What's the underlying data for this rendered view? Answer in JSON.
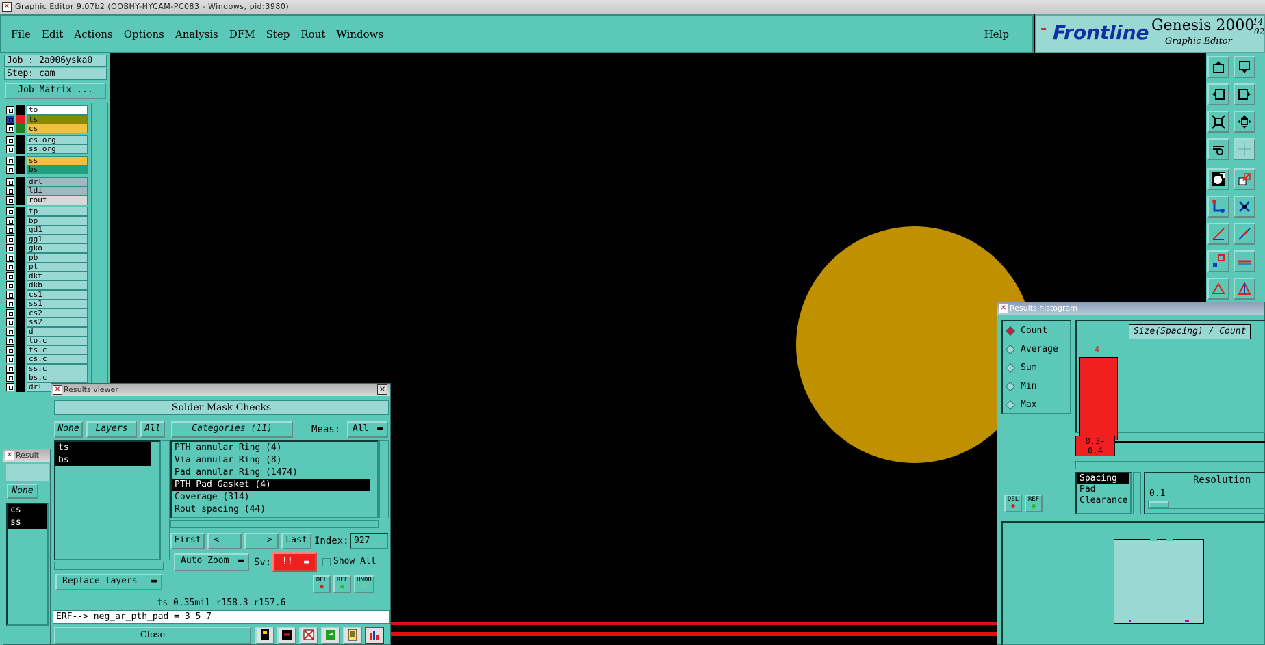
{
  "window": {
    "title": "Graphic Editor 9.07b2 (OOBHY-HYCAM-PC083 - Windows, pid:3980)"
  },
  "menu": {
    "items": [
      "File",
      "Edit",
      "Actions",
      "Options",
      "Analysis",
      "DFM",
      "Step",
      "Rout",
      "Windows"
    ],
    "help": "Help"
  },
  "logo": {
    "brand": "Frontline",
    "product": "Genesis 2000",
    "subtitle": "Graphic Editor",
    "version_top": "14",
    "version_bottom": "02"
  },
  "job": {
    "job_label": "Job : 2a006yska0",
    "step_label": "Step: cam",
    "matrix_button": "Job Matrix ..."
  },
  "layers": [
    {
      "name": "to",
      "color": "#ffffff"
    },
    {
      "name": "ts",
      "color": "#8a8a00",
      "swatch": "#e02020",
      "active": true
    },
    {
      "name": "cs",
      "color": "#f0c040",
      "swatch": "#208020"
    },
    {
      "name": "cs.org",
      "color": "#9ad8d4"
    },
    {
      "name": "ss.org",
      "color": "#9ad8d4"
    },
    {
      "name": "ss",
      "color": "#f0c040"
    },
    {
      "name": "bs",
      "color": "#20a080"
    },
    {
      "name": "drl",
      "color": "#a0b8c0"
    },
    {
      "name": "ldi",
      "color": "#a0b8c0"
    },
    {
      "name": "rout",
      "color": "#d8d8d8"
    },
    {
      "name": "tp",
      "color": "#9ad8d4"
    },
    {
      "name": "bp",
      "color": "#9ad8d4"
    },
    {
      "name": "gd1",
      "color": "#9ad8d4"
    },
    {
      "name": "gg1",
      "color": "#9ad8d4"
    },
    {
      "name": "gko",
      "color": "#9ad8d4"
    },
    {
      "name": "pb",
      "color": "#9ad8d4"
    },
    {
      "name": "pt",
      "color": "#9ad8d4"
    },
    {
      "name": "dkt",
      "color": "#9ad8d4"
    },
    {
      "name": "dkb",
      "color": "#9ad8d4"
    },
    {
      "name": "cs1",
      "color": "#9ad8d4"
    },
    {
      "name": "ss1",
      "color": "#9ad8d4"
    },
    {
      "name": "cs2",
      "color": "#9ad8d4"
    },
    {
      "name": "ss2",
      "color": "#9ad8d4"
    },
    {
      "name": "d",
      "color": "#9ad8d4"
    },
    {
      "name": "to.c",
      "color": "#9ad8d4"
    },
    {
      "name": "ts.c",
      "color": "#9ad8d4"
    },
    {
      "name": "cs.c",
      "color": "#9ad8d4"
    },
    {
      "name": "ss.c",
      "color": "#9ad8d4"
    },
    {
      "name": "bs.c",
      "color": "#9ad8d4"
    },
    {
      "name": "drl",
      "color": "#9ad8d4"
    }
  ],
  "back_viewer": {
    "title": "Result",
    "none_btn": "None",
    "items": [
      "cs",
      "ss"
    ]
  },
  "results_viewer": {
    "title": "Results viewer",
    "header": "Solder Mask Checks",
    "none_btn": "None",
    "layers_btn": "Layers",
    "all_btn": "All",
    "categories_btn": "Categories (11)",
    "meas_label": "Meas:",
    "meas_value": "All",
    "layer_items": [
      "ts",
      "bs"
    ],
    "categories": [
      "PTH annular Ring (4)",
      "Via annular Ring (8)",
      "Pad annular Ring (1474)",
      "PTH Pad Gasket (4)",
      "Coverage (314)",
      "Rout spacing (44)"
    ],
    "selected_category": 3,
    "first_btn": "First",
    "prev_btn": "<---",
    "next_btn": "--->",
    "last_btn": "Last",
    "index_label": "Index:",
    "index_value": "927",
    "auto_zoom": "Auto Zoom",
    "sv_label": "Sv:",
    "sv_value": "!!",
    "show_all": "Show All",
    "replace_layers": "Replace layers",
    "del": "DEL",
    "ref": "REF",
    "undo": "UNDO",
    "status": "ts 0.35mil  r158.3  r157.6",
    "erf": "ERF--> neg_ar_pth_pad = 3 5 7",
    "close": "Close"
  },
  "histogram": {
    "title": "Results histogram",
    "modes": [
      "Count",
      "Average",
      "Sum",
      "Min",
      "Max"
    ],
    "selected_mode": 0,
    "chart_title": "Size(Spacing) / Count",
    "bar_value": "4",
    "bar_label": "0.3-\n0.4",
    "bar_color": "#f02020",
    "types": [
      "Spacing",
      "Pad",
      "Clearance"
    ],
    "resolution_label": "Resolution",
    "resolution_value": "0.1",
    "del": "DEL",
    "ref": "REF"
  },
  "canvas": {
    "pad_color": "#bf9000",
    "trace_color": "#e01010"
  }
}
